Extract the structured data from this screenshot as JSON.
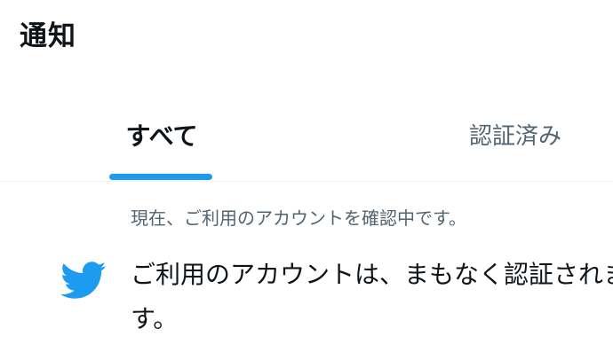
{
  "header": {
    "title": "通知"
  },
  "tabs": [
    {
      "label": "すべて",
      "active": true
    },
    {
      "label": "認証済み",
      "active": false
    }
  ],
  "notification": {
    "meta": "現在、ご利用のアカウントを確認中です。",
    "body": "ご利用のアカウントは、まもなく認証されます。",
    "icon": "twitter-bird-icon"
  },
  "colors": {
    "accent": "#1d9bf0",
    "text_primary": "#0f1419",
    "text_secondary": "#536471",
    "divider": "#eff3f4"
  }
}
